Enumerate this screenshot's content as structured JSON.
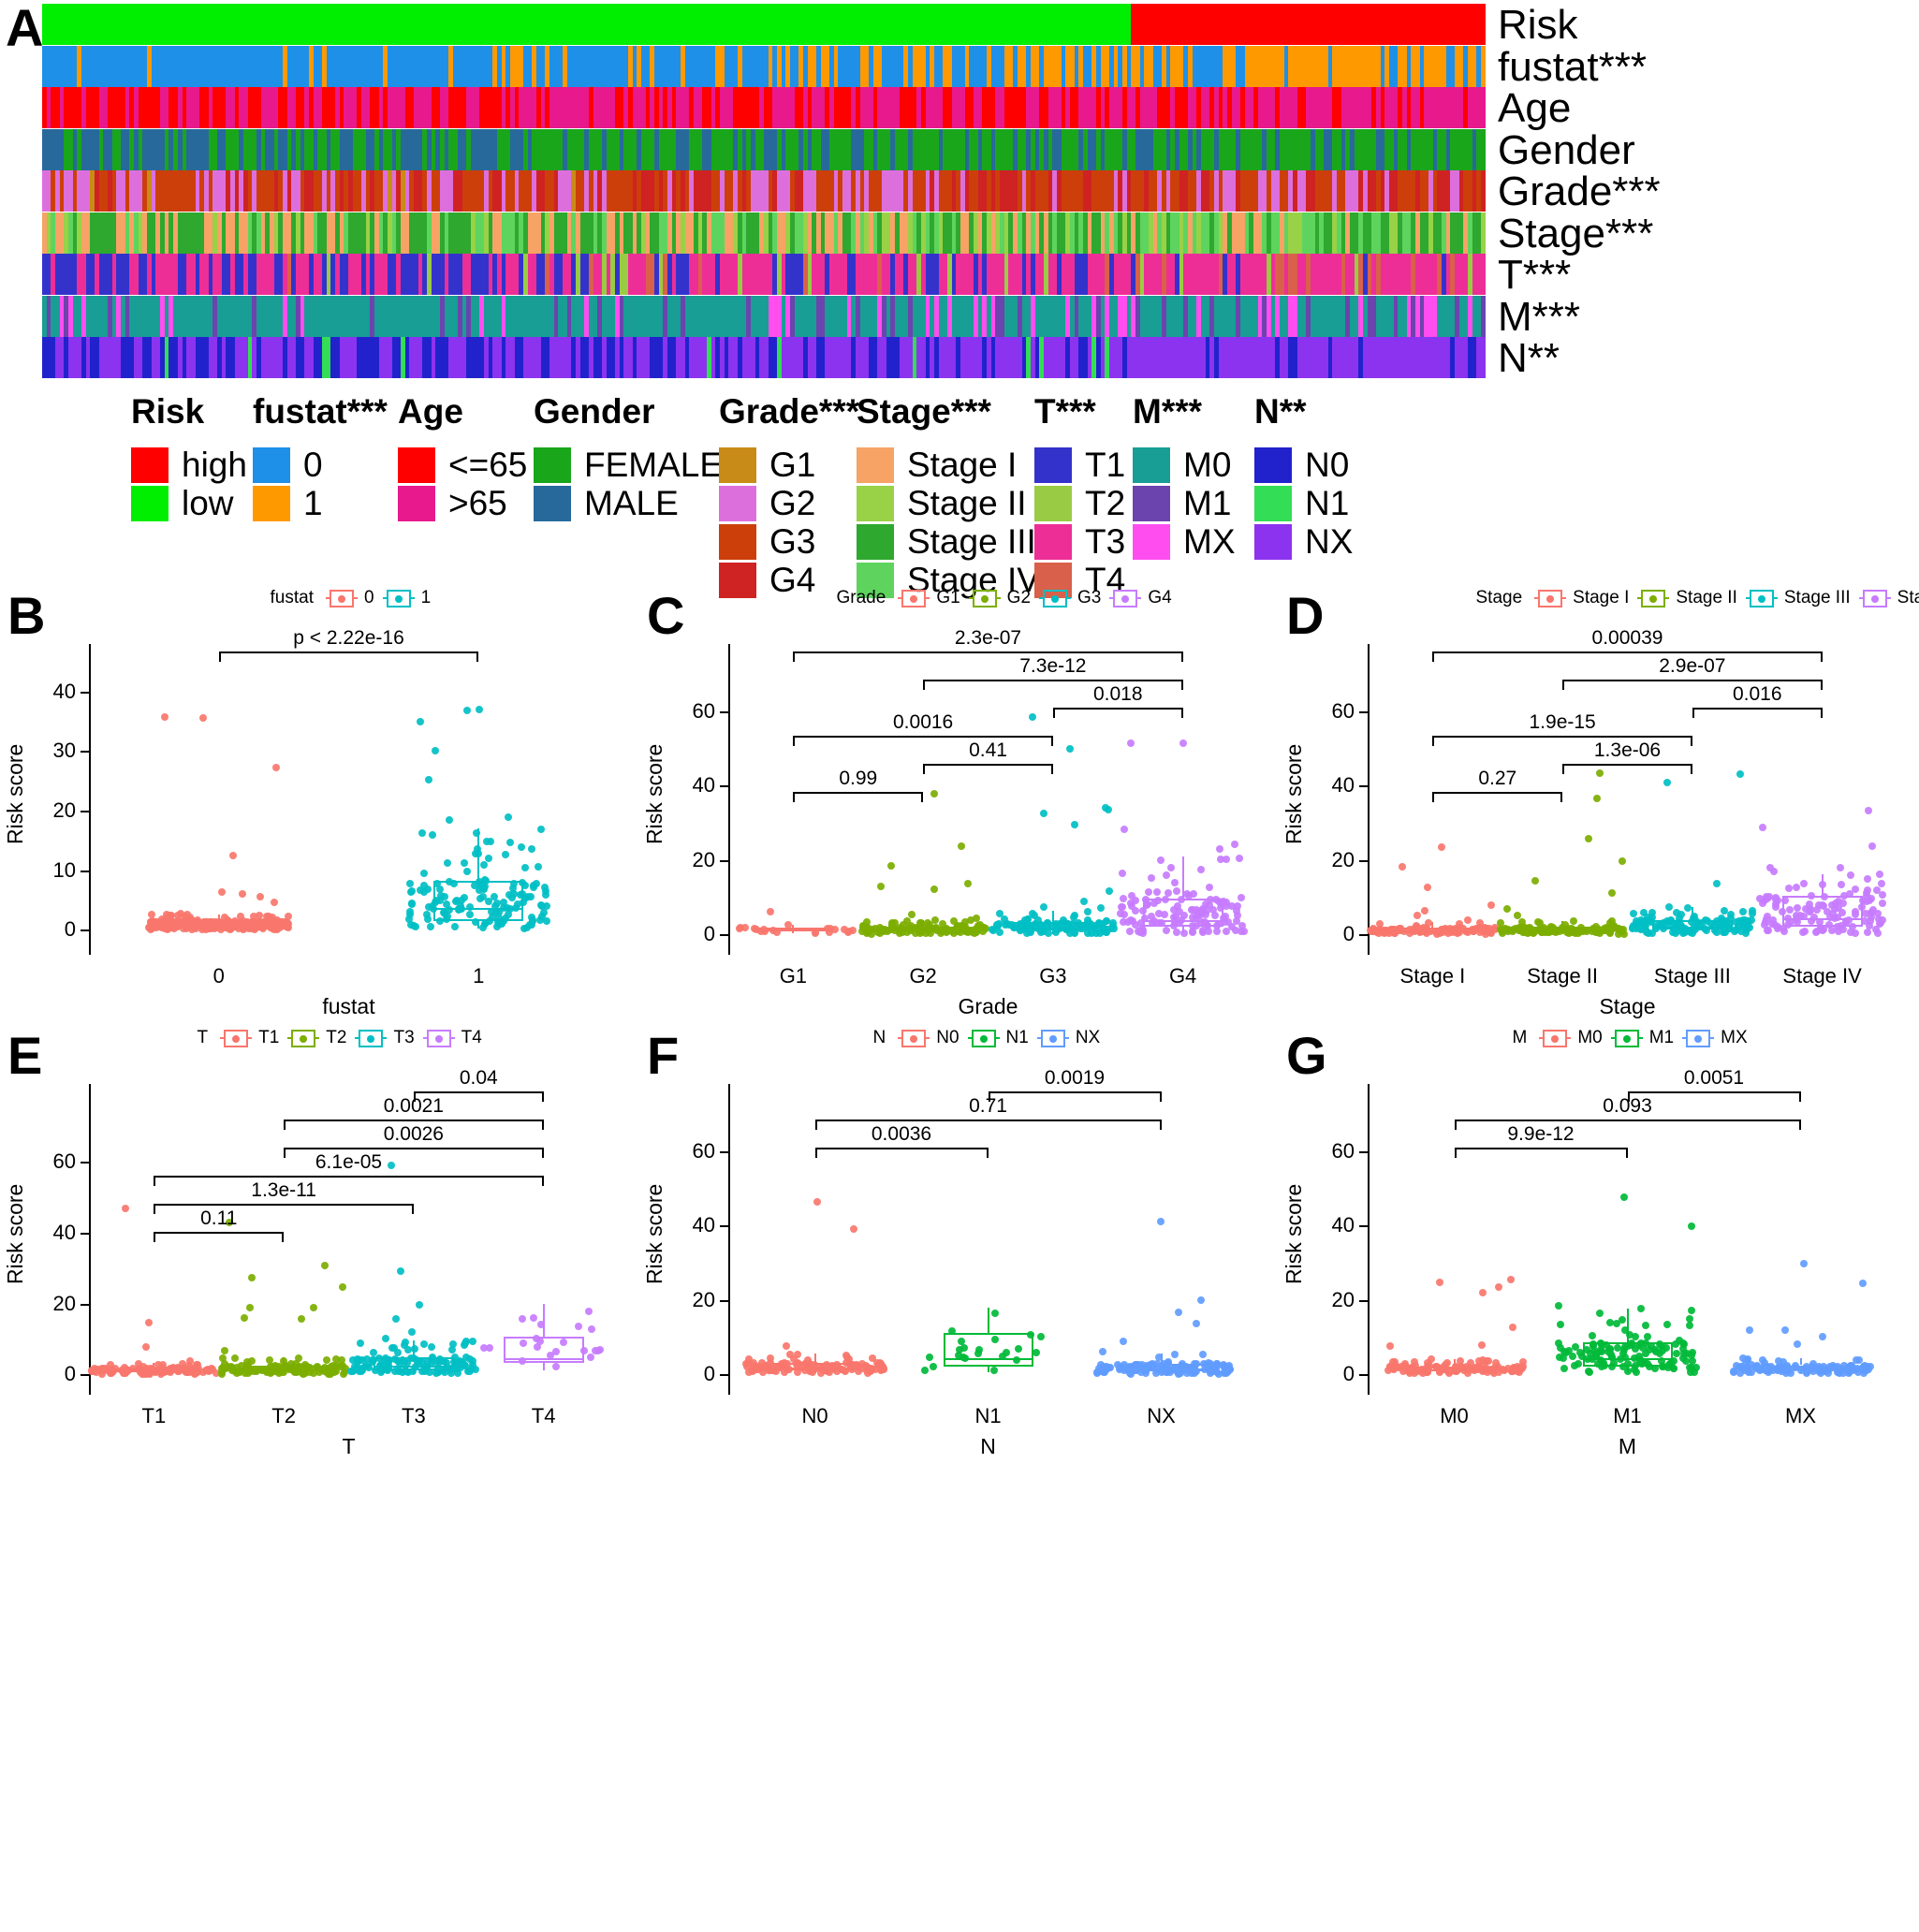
{
  "panels": {
    "a": "A",
    "b": "B",
    "c": "C",
    "d": "D",
    "e": "E",
    "f": "F",
    "g": "G"
  },
  "heatmap": {
    "rows": [
      {
        "name": "Risk",
        "label": "Risk"
      },
      {
        "name": "fustat",
        "label": "fustat***"
      },
      {
        "name": "Age",
        "label": "Age"
      },
      {
        "name": "Gender",
        "label": "Gender"
      },
      {
        "name": "Grade",
        "label": "Grade***"
      },
      {
        "name": "Stage",
        "label": "Stage***"
      },
      {
        "name": "T",
        "label": "T***"
      },
      {
        "name": "M",
        "label": "M***"
      },
      {
        "name": "N",
        "label": "N**"
      }
    ]
  },
  "legend_a": [
    {
      "title": "Risk",
      "items": [
        {
          "label": "high",
          "color": "#FF0000"
        },
        {
          "label": "low",
          "color": "#00EE00"
        }
      ]
    },
    {
      "title": "fustat***",
      "items": [
        {
          "label": "0",
          "color": "#1E90E8"
        },
        {
          "label": "1",
          "color": "#FF9900"
        }
      ]
    },
    {
      "title": "Age",
      "items": [
        {
          "label": "<=65",
          "color": "#FF0000"
        },
        {
          "label": ">65",
          "color": "#E8198C"
        }
      ]
    },
    {
      "title": "Gender",
      "items": [
        {
          "label": "FEMALE",
          "color": "#1AA61A"
        },
        {
          "label": "MALE",
          "color": "#27699B"
        }
      ]
    },
    {
      "title": "Grade***",
      "items": [
        {
          "label": "G1",
          "color": "#C98B17"
        },
        {
          "label": "G2",
          "color": "#DD6FDD"
        },
        {
          "label": "G3",
          "color": "#CC3F0A"
        },
        {
          "label": "G4",
          "color": "#CF2222"
        }
      ]
    },
    {
      "title": "Stage***",
      "items": [
        {
          "label": "Stage I",
          "color": "#F6A365"
        },
        {
          "label": "Stage II",
          "color": "#99D147"
        },
        {
          "label": "Stage III",
          "color": "#2EA82E"
        },
        {
          "label": "Stage IV",
          "color": "#5ED45E"
        }
      ]
    },
    {
      "title": "T***",
      "items": [
        {
          "label": "T1",
          "color": "#3333CC"
        },
        {
          "label": "T2",
          "color": "#99CC44"
        },
        {
          "label": "T3",
          "color": "#ED2E96"
        },
        {
          "label": "T4",
          "color": "#D9604A"
        }
      ]
    },
    {
      "title": "M***",
      "items": [
        {
          "label": "M0",
          "color": "#189E95"
        },
        {
          "label": "M1",
          "color": "#6B44AD"
        },
        {
          "label": "MX",
          "color": "#FF4DF0"
        }
      ]
    },
    {
      "title": "N**",
      "items": [
        {
          "label": "N0",
          "color": "#2222CC"
        },
        {
          "label": "N1",
          "color": "#33DD55"
        },
        {
          "label": "NX",
          "color": "#8B33EE"
        }
      ]
    }
  ],
  "chart_data": [
    {
      "panel": "B",
      "type": "boxplot",
      "legend_title": "fustat",
      "legend": [
        {
          "label": "0",
          "color": "#F8766D"
        },
        {
          "label": "1",
          "color": "#00BFC4"
        }
      ],
      "xlabel": "fustat",
      "ylabel": "Risk score",
      "categories": [
        "0",
        "1"
      ],
      "yticks": [
        0,
        10,
        20,
        30,
        40
      ],
      "ylim": [
        -2,
        48
      ],
      "boxes": [
        {
          "cat": "0",
          "color": "#F8766D",
          "q1": 0.4,
          "median": 0.85,
          "q3": 1.4,
          "lower": 0.05,
          "upper": 2.6
        },
        {
          "cat": "1",
          "color": "#00BFC4",
          "q1": 1.5,
          "median": 3.6,
          "q3": 8.2,
          "lower": 0.2,
          "upper": 17.0
        }
      ],
      "comparisons": [
        {
          "groups": [
            "0",
            "1"
          ],
          "p": "p < 2.22e-16"
        }
      ]
    },
    {
      "panel": "C",
      "type": "boxplot",
      "legend_title": "Grade",
      "legend": [
        {
          "label": "G1",
          "color": "#F8766D"
        },
        {
          "label": "G2",
          "color": "#7CAE00"
        },
        {
          "label": "G3",
          "color": "#00BFC4"
        },
        {
          "label": "G4",
          "color": "#C77CFF"
        }
      ],
      "xlabel": "Grade",
      "ylabel": "Risk score",
      "categories": [
        "G1",
        "G2",
        "G3",
        "G4"
      ],
      "yticks": [
        0,
        20,
        40,
        60
      ],
      "ylim": [
        -2,
        78
      ],
      "boxes": [
        {
          "cat": "G1",
          "color": "#F8766D",
          "q1": 0.8,
          "median": 1.2,
          "q3": 1.7,
          "lower": 0.3,
          "upper": 2.6
        },
        {
          "cat": "G2",
          "color": "#7CAE00",
          "q1": 0.7,
          "median": 1.2,
          "q3": 2.0,
          "lower": 0.1,
          "upper": 3.8
        },
        {
          "cat": "G3",
          "color": "#00BFC4",
          "q1": 1.0,
          "median": 1.8,
          "q3": 3.2,
          "lower": 0.1,
          "upper": 6.3
        },
        {
          "cat": "G4",
          "color": "#C77CFF",
          "q1": 1.9,
          "median": 3.9,
          "q3": 9.6,
          "lower": 0.3,
          "upper": 21.0
        }
      ],
      "comparisons": [
        {
          "groups": [
            "G1",
            "G2"
          ],
          "p": "0.99"
        },
        {
          "groups": [
            "G2",
            "G3"
          ],
          "p": "0.41"
        },
        {
          "groups": [
            "G1",
            "G3"
          ],
          "p": "0.0016"
        },
        {
          "groups": [
            "G3",
            "G4"
          ],
          "p": "0.018"
        },
        {
          "groups": [
            "G2",
            "G4"
          ],
          "p": "7.3e-12"
        },
        {
          "groups": [
            "G1",
            "G4"
          ],
          "p": "2.3e-07"
        }
      ]
    },
    {
      "panel": "D",
      "type": "boxplot",
      "legend_title": "Stage",
      "legend": [
        {
          "label": "Stage I",
          "color": "#F8766D"
        },
        {
          "label": "Stage II",
          "color": "#7CAE00"
        },
        {
          "label": "Stage III",
          "color": "#00BFC4"
        },
        {
          "label": "Stage IV",
          "color": "#C77CFF"
        }
      ],
      "xlabel": "Stage",
      "ylabel": "Risk score",
      "categories": [
        "Stage I",
        "Stage II",
        "Stage III",
        "Stage IV"
      ],
      "yticks": [
        0,
        20,
        40,
        60
      ],
      "ylim": [
        -2,
        78
      ],
      "boxes": [
        {
          "cat": "Stage I",
          "color": "#F8766D",
          "q1": 0.6,
          "median": 1.1,
          "q3": 1.7,
          "lower": 0.1,
          "upper": 3.2
        },
        {
          "cat": "Stage II",
          "color": "#7CAE00",
          "q1": 0.7,
          "median": 1.2,
          "q3": 1.9,
          "lower": 0.1,
          "upper": 3.6
        },
        {
          "cat": "Stage III",
          "color": "#00BFC4",
          "q1": 1.2,
          "median": 2.1,
          "q3": 3.8,
          "lower": 0.2,
          "upper": 7.2
        },
        {
          "cat": "Stage IV",
          "color": "#C77CFF",
          "q1": 2.0,
          "median": 4.4,
          "q3": 10.4,
          "lower": 0.3,
          "upper": 16.0
        }
      ],
      "comparisons": [
        {
          "groups": [
            "Stage I",
            "Stage II"
          ],
          "p": "0.27"
        },
        {
          "groups": [
            "Stage II",
            "Stage III"
          ],
          "p": "1.3e-06"
        },
        {
          "groups": [
            "Stage I",
            "Stage III"
          ],
          "p": "1.9e-15"
        },
        {
          "groups": [
            "Stage III",
            "Stage IV"
          ],
          "p": "0.016"
        },
        {
          "groups": [
            "Stage II",
            "Stage IV"
          ],
          "p": "2.9e-07"
        },
        {
          "groups": [
            "Stage I",
            "Stage IV"
          ],
          "p": "0.00039"
        }
      ]
    },
    {
      "panel": "E",
      "type": "boxplot",
      "legend_title": "T",
      "legend": [
        {
          "label": "T1",
          "color": "#F8766D"
        },
        {
          "label": "T2",
          "color": "#7CAE00"
        },
        {
          "label": "T3",
          "color": "#00BFC4"
        },
        {
          "label": "T4",
          "color": "#C77CFF"
        }
      ],
      "xlabel": "T",
      "ylabel": "Risk score",
      "categories": [
        "T1",
        "T2",
        "T3",
        "T4"
      ],
      "yticks": [
        0,
        20,
        40,
        60
      ],
      "ylim": [
        -2,
        82
      ],
      "boxes": [
        {
          "cat": "T1",
          "color": "#F8766D",
          "q1": 0.6,
          "median": 1.1,
          "q3": 1.7,
          "lower": 0.1,
          "upper": 3.2
        },
        {
          "cat": "T2",
          "color": "#7CAE00",
          "q1": 0.8,
          "median": 1.5,
          "q3": 2.5,
          "lower": 0.1,
          "upper": 4.8
        },
        {
          "cat": "T3",
          "color": "#00BFC4",
          "q1": 1.3,
          "median": 2.5,
          "q3": 4.8,
          "lower": 0.2,
          "upper": 9.5
        },
        {
          "cat": "T4",
          "color": "#C77CFF",
          "q1": 3.4,
          "median": 4.6,
          "q3": 10.6,
          "lower": 1.2,
          "upper": 20.0
        }
      ],
      "comparisons": [
        {
          "groups": [
            "T1",
            "T2"
          ],
          "p": "0.11"
        },
        {
          "groups": [
            "T1",
            "T3"
          ],
          "p": "1.3e-11"
        },
        {
          "groups": [
            "T1",
            "T4"
          ],
          "p": "6.1e-05"
        },
        {
          "groups": [
            "T2",
            "T4"
          ],
          "p": "0.0026"
        },
        {
          "groups": [
            "T2",
            "T4"
          ],
          "p": "0.0021"
        },
        {
          "groups": [
            "T3",
            "T4"
          ],
          "p": "0.04"
        }
      ]
    },
    {
      "panel": "F",
      "type": "boxplot",
      "legend_title": "N",
      "legend": [
        {
          "label": "N0",
          "color": "#F8766D"
        },
        {
          "label": "N1",
          "color": "#00BA38"
        },
        {
          "label": "NX",
          "color": "#619CFF"
        }
      ],
      "xlabel": "N",
      "ylabel": "Risk score",
      "categories": [
        "N0",
        "N1",
        "NX"
      ],
      "yticks": [
        0,
        20,
        40,
        60
      ],
      "ylim": [
        -2,
        78
      ],
      "boxes": [
        {
          "cat": "N0",
          "color": "#F8766D",
          "q1": 1.0,
          "median": 1.8,
          "q3": 3.0,
          "lower": 0.2,
          "upper": 5.6
        },
        {
          "cat": "N1",
          "color": "#00BA38",
          "q1": 2.1,
          "median": 4.3,
          "q3": 11.2,
          "lower": 0.5,
          "upper": 18.0
        },
        {
          "cat": "NX",
          "color": "#619CFF",
          "q1": 0.8,
          "median": 1.6,
          "q3": 2.9,
          "lower": 0.1,
          "upper": 5.6
        }
      ],
      "comparisons": [
        {
          "groups": [
            "N0",
            "N1"
          ],
          "p": "0.0036"
        },
        {
          "groups": [
            "N0",
            "NX"
          ],
          "p": "0.71"
        },
        {
          "groups": [
            "N1",
            "NX"
          ],
          "p": "0.0019"
        }
      ]
    },
    {
      "panel": "G",
      "type": "boxplot",
      "legend_title": "M",
      "legend": [
        {
          "label": "M0",
          "color": "#F8766D"
        },
        {
          "label": "M1",
          "color": "#00BA38"
        },
        {
          "label": "MX",
          "color": "#619CFF"
        }
      ],
      "xlabel": "M",
      "ylabel": "Risk score",
      "categories": [
        "M0",
        "M1",
        "MX"
      ],
      "yticks": [
        0,
        20,
        40,
        60
      ],
      "ylim": [
        -2,
        78
      ],
      "boxes": [
        {
          "cat": "M0",
          "color": "#F8766D",
          "q1": 0.7,
          "median": 1.3,
          "q3": 2.1,
          "lower": 0.1,
          "upper": 4.0
        },
        {
          "cat": "M1",
          "color": "#00BA38",
          "q1": 2.0,
          "median": 4.2,
          "q3": 8.6,
          "lower": 0.4,
          "upper": 17.5
        },
        {
          "cat": "MX",
          "color": "#619CFF",
          "q1": 0.9,
          "median": 1.5,
          "q3": 2.4,
          "lower": 0.2,
          "upper": 4.4
        }
      ],
      "comparisons": [
        {
          "groups": [
            "M0",
            "M1"
          ],
          "p": "9.9e-12"
        },
        {
          "groups": [
            "M0",
            "MX"
          ],
          "p": "0.093"
        },
        {
          "groups": [
            "M1",
            "MX"
          ],
          "p": "0.0051"
        }
      ]
    }
  ]
}
